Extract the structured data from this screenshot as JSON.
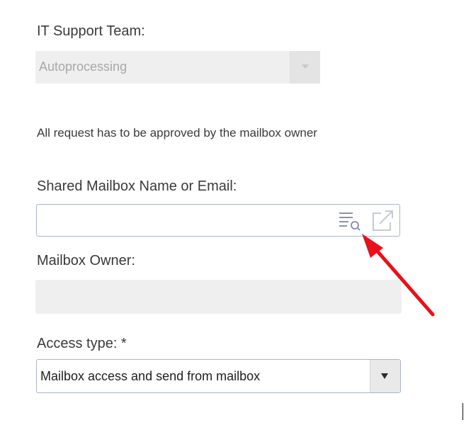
{
  "form": {
    "it_support_team": {
      "label": "IT Support Team:",
      "value": "Autoprocessing",
      "disabled": true
    },
    "approval_note": "All request has to be approved by the mailbox owner",
    "shared_mailbox": {
      "label": "Shared Mailbox Name or Email:",
      "value": "",
      "lookup_icon": "list-search-icon",
      "open_icon": "open-external-icon"
    },
    "mailbox_owner": {
      "label": "Mailbox Owner:",
      "value": ""
    },
    "access_type": {
      "label": "Access type: *",
      "value": "Mailbox access and send from mailbox"
    }
  },
  "annotation": {
    "arrow_color": "#e8101a"
  },
  "colors": {
    "field_border": "#a9b5c5",
    "disabled_bg": "#efefef",
    "icon_gray": "#8a96a6"
  }
}
